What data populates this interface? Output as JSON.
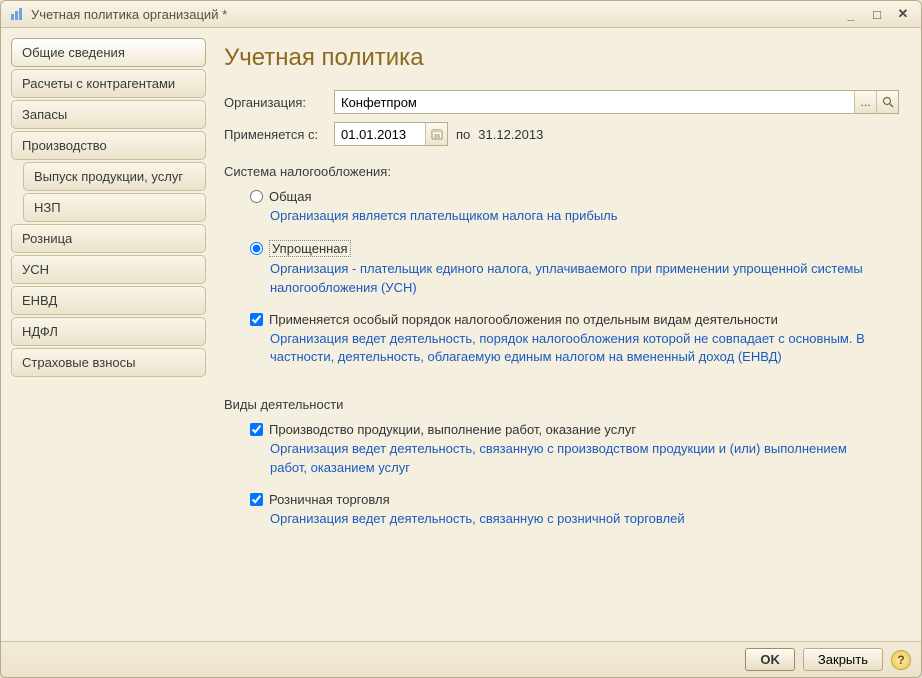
{
  "window": {
    "title": "Учетная политика организаций *"
  },
  "sidebar": {
    "items": [
      {
        "label": "Общие сведения"
      },
      {
        "label": "Расчеты с контрагентами"
      },
      {
        "label": "Запасы"
      },
      {
        "label": "Производство"
      },
      {
        "label": "Выпуск продукции, услуг"
      },
      {
        "label": "НЗП"
      },
      {
        "label": "Розница"
      },
      {
        "label": "УСН"
      },
      {
        "label": "ЕНВД"
      },
      {
        "label": "НДФЛ"
      },
      {
        "label": "Страховые взносы"
      }
    ]
  },
  "page": {
    "title": "Учетная политика"
  },
  "form": {
    "org_label": "Организация:",
    "org_value": "Конфетпром",
    "date_label": "Применяется с:",
    "date_value": "01.01.2013",
    "po_label": "по",
    "date_to": "31.12.2013"
  },
  "tax_system": {
    "section_label": "Система налогообложения:",
    "general": {
      "label": "Общая",
      "hint": "Организация является плательщиком налога на прибыль"
    },
    "simplified": {
      "label": "Упрощенная",
      "hint": "Организация - плательщик единого налога, уплачиваемого при применении упрощенной системы налогообложения (УСН)"
    },
    "special": {
      "label": "Применяется особый порядок налогообложения по отдельным видам деятельности",
      "hint": "Организация ведет деятельность, порядок налогообложения которой не совпадает с основным. В частности, деятельность, облагаемую единым налогом на вмененный доход (ЕНВД)"
    }
  },
  "activities": {
    "section_label": "Виды деятельности",
    "production": {
      "label": "Производство  продукции, выполнение работ, оказание услуг",
      "hint": "Организация ведет деятельность, связанную с производством продукции и (или) выполнением работ, оказанием услуг"
    },
    "retail": {
      "label": "Розничная торговля",
      "hint": "Организация ведет деятельность, связанную с розничной торговлей"
    }
  },
  "footer": {
    "ok": "OK",
    "close": "Закрыть"
  }
}
